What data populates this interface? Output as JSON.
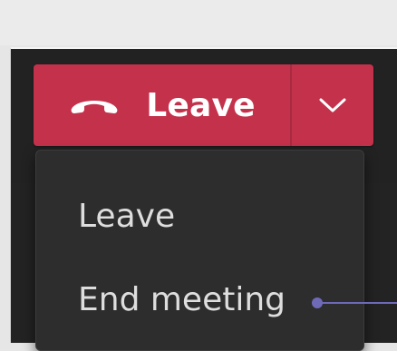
{
  "leave_button": {
    "label": "Leave",
    "icon": "phone-hangup-icon",
    "dropdown_icon": "chevron-down-icon",
    "color": "#c4314b"
  },
  "leave_menu": {
    "items": [
      {
        "label": "Leave"
      },
      {
        "label": "End meeting"
      }
    ]
  },
  "callout": {
    "color": "#6e6ab8"
  }
}
